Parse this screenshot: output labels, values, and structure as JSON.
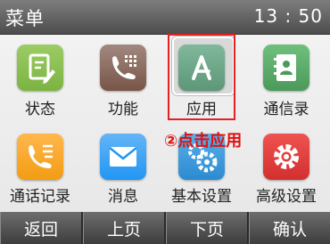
{
  "header": {
    "title": "菜单",
    "time": "13 : 50"
  },
  "menu_items": [
    {
      "label": "状态",
      "icon": "status-icon",
      "color": "#8bc34a"
    },
    {
      "label": "功能",
      "icon": "feature-icon",
      "color": "#8d6e63"
    },
    {
      "label": "应用",
      "icon": "app-icon",
      "color": "#6fa889",
      "selected": true
    },
    {
      "label": "通信录",
      "icon": "contacts-icon",
      "color": "#5aa469"
    },
    {
      "label": "通话记录",
      "icon": "call-log-icon",
      "color": "#f6a821"
    },
    {
      "label": "消息",
      "icon": "message-icon",
      "color": "#3da6e8"
    },
    {
      "label": "基本设置",
      "icon": "basic-settings-icon",
      "color": "#3aa0e0"
    },
    {
      "label": "高级设置",
      "icon": "advanced-settings-icon",
      "color": "#e53935"
    }
  ],
  "annotation": "②点击应用",
  "softkeys": [
    "返回",
    "上页",
    "下页",
    "确认"
  ],
  "colors": {
    "highlight": "#e52222",
    "annotation": "#e01010"
  }
}
